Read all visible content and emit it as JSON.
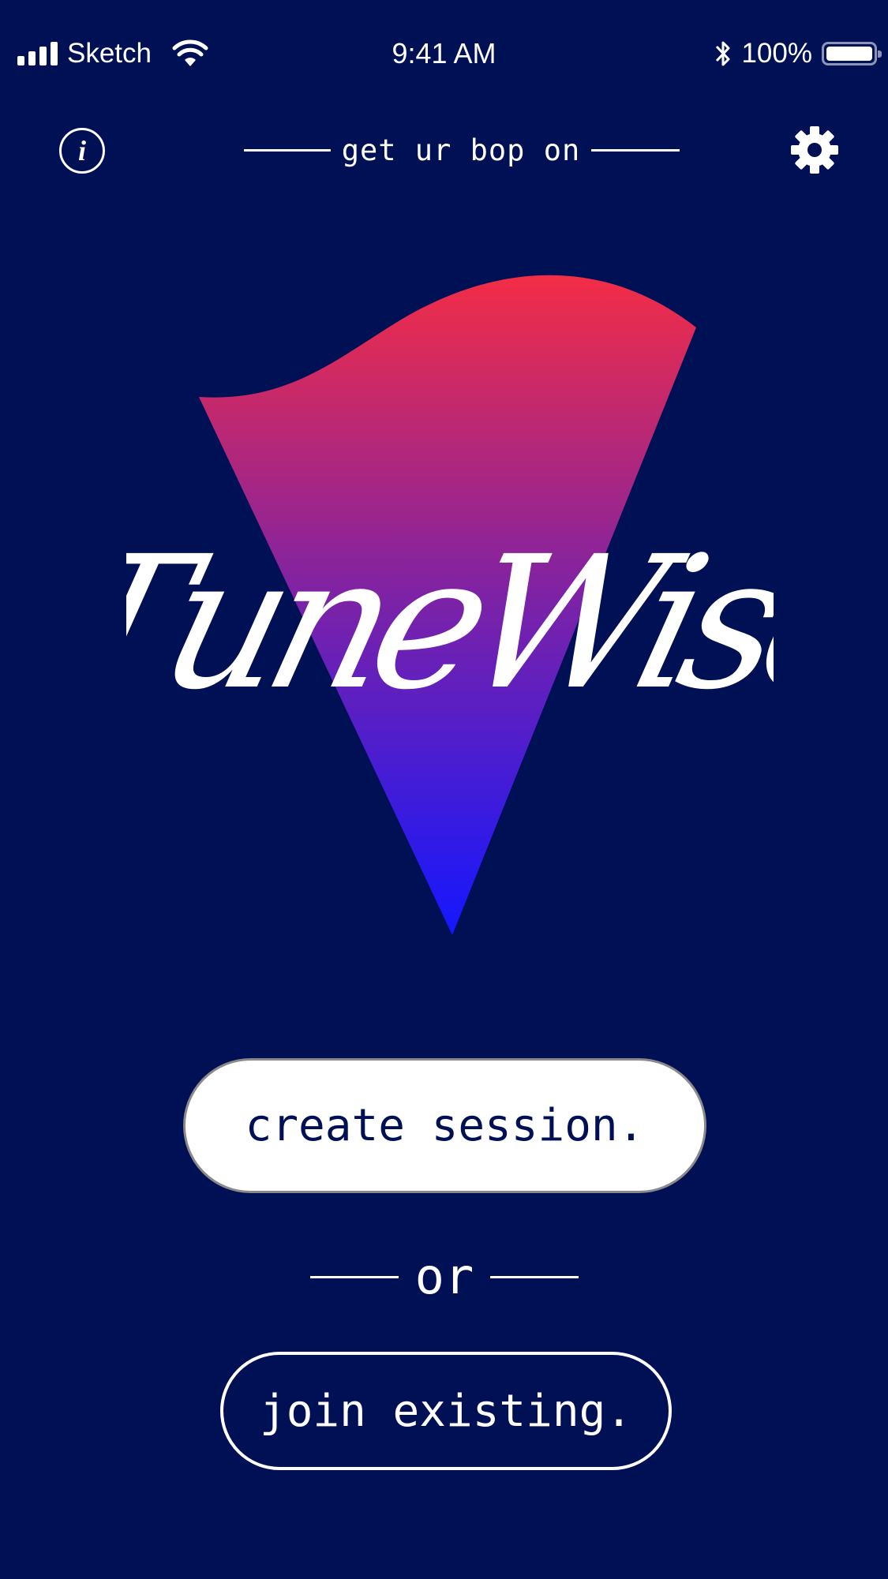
{
  "status_bar": {
    "carrier": "Sketch",
    "time": "9:41 AM",
    "battery": "100%",
    "icons": [
      "signal-icon",
      "wifi-icon",
      "bluetooth-icon",
      "battery-icon"
    ]
  },
  "header": {
    "info_symbol": "i",
    "tagline": "get ur bop on",
    "icons": [
      "info-icon",
      "gear-icon"
    ]
  },
  "logo": {
    "wordmark": "TuneWise",
    "gradient_top": "#f32d46",
    "gradient_mid": "#7a22a8",
    "gradient_bottom": "#1417ff"
  },
  "actions": {
    "create_label": "create session.",
    "or_label": "or",
    "join_label": "join existing."
  },
  "colors": {
    "background": "#001055",
    "foreground": "#ffffff"
  }
}
